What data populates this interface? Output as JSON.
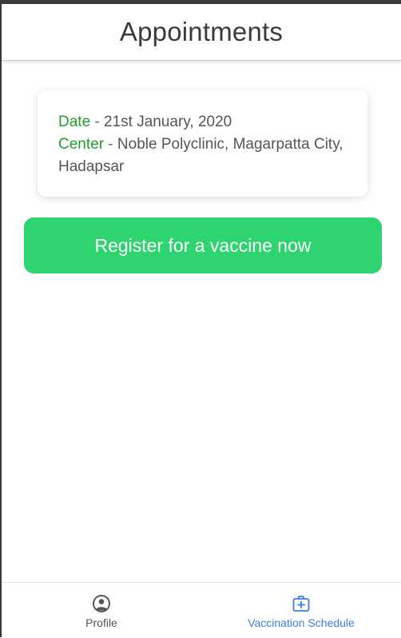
{
  "header": {
    "title": "Appointments"
  },
  "appointment": {
    "date_label": "Date",
    "separator": " - ",
    "date_value": "21st January, 2020",
    "center_label": "Center",
    "center_value": "Noble Polyclinic, Magarpatta City, Hadapsar"
  },
  "register_button": {
    "label": "Register for a vaccine now"
  },
  "bottom_nav": {
    "tabs": [
      {
        "label": "Profile",
        "icon": "profile-icon",
        "active": false
      },
      {
        "label": "Vaccination Schedule",
        "icon": "medical-kit-icon",
        "active": true
      }
    ]
  },
  "colors": {
    "accent_green": "#2dd46f",
    "label_green": "#1f9e2e",
    "active_tab": "#3b7de0",
    "inactive_tab": "#555555"
  }
}
